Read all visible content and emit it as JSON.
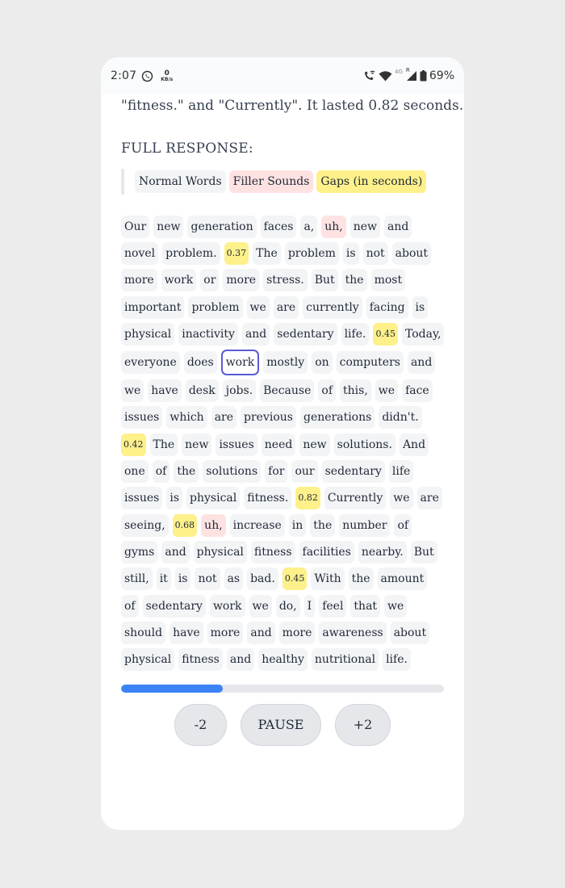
{
  "status": {
    "time": "2:07",
    "net_speed": "0",
    "net_unit": "KB/s",
    "network": "4G",
    "signal_sup": "R",
    "battery": "69%"
  },
  "summary_line": "\"fitness.\" and \"Currently\". It lasted 0.82 seconds.",
  "section_title": "FULL RESPONSE:",
  "legend": {
    "normal": "Normal Words",
    "filler": "Filler Sounds",
    "gap": "Gaps (in seconds)"
  },
  "transcript_rows": [
    [
      {
        "t": "Our",
        "k": "normal"
      },
      {
        "t": "new",
        "k": "normal"
      },
      {
        "t": "generation",
        "k": "normal"
      },
      {
        "t": "faces",
        "k": "normal"
      },
      {
        "t": "a,",
        "k": "normal"
      },
      {
        "t": "uh,",
        "k": "filler"
      },
      {
        "t": "new",
        "k": "normal"
      },
      {
        "t": "and",
        "k": "normal"
      }
    ],
    [
      {
        "t": "novel",
        "k": "normal"
      },
      {
        "t": "problem.",
        "k": "normal"
      },
      {
        "t": "0.37",
        "k": "gap"
      },
      {
        "t": "The",
        "k": "normal"
      },
      {
        "t": "problem",
        "k": "normal"
      },
      {
        "t": "is",
        "k": "normal"
      },
      {
        "t": "not",
        "k": "normal"
      },
      {
        "t": "about",
        "k": "normal"
      }
    ],
    [
      {
        "t": "more",
        "k": "normal"
      },
      {
        "t": "work",
        "k": "normal"
      },
      {
        "t": "or",
        "k": "normal"
      },
      {
        "t": "more",
        "k": "normal"
      },
      {
        "t": "stress.",
        "k": "normal"
      },
      {
        "t": "But",
        "k": "normal"
      },
      {
        "t": "the",
        "k": "normal"
      },
      {
        "t": "most",
        "k": "normal"
      }
    ],
    [
      {
        "t": "important",
        "k": "normal"
      },
      {
        "t": "problem",
        "k": "normal"
      },
      {
        "t": "we",
        "k": "normal"
      },
      {
        "t": "are",
        "k": "normal"
      },
      {
        "t": "currently",
        "k": "normal"
      },
      {
        "t": "facing",
        "k": "normal"
      },
      {
        "t": "is",
        "k": "normal"
      }
    ],
    [
      {
        "t": "physical",
        "k": "normal"
      },
      {
        "t": "inactivity",
        "k": "normal"
      },
      {
        "t": "and",
        "k": "normal"
      },
      {
        "t": "sedentary",
        "k": "normal"
      },
      {
        "t": "life.",
        "k": "normal"
      },
      {
        "t": "0.45",
        "k": "gap"
      },
      {
        "t": "Today,",
        "k": "normal"
      }
    ],
    [
      {
        "t": "everyone",
        "k": "normal"
      },
      {
        "t": "does",
        "k": "normal"
      },
      {
        "t": "work",
        "k": "active"
      },
      {
        "t": "mostly",
        "k": "normal"
      },
      {
        "t": "on",
        "k": "normal"
      },
      {
        "t": "computers",
        "k": "normal"
      },
      {
        "t": "and",
        "k": "normal"
      }
    ],
    [
      {
        "t": "we",
        "k": "normal"
      },
      {
        "t": "have",
        "k": "normal"
      },
      {
        "t": "desk",
        "k": "normal"
      },
      {
        "t": "jobs.",
        "k": "normal"
      },
      {
        "t": "Because",
        "k": "normal"
      },
      {
        "t": "of",
        "k": "normal"
      },
      {
        "t": "this,",
        "k": "normal"
      },
      {
        "t": "we",
        "k": "normal"
      },
      {
        "t": "face",
        "k": "normal"
      }
    ],
    [
      {
        "t": "issues",
        "k": "normal"
      },
      {
        "t": "which",
        "k": "normal"
      },
      {
        "t": "are",
        "k": "normal"
      },
      {
        "t": "previous",
        "k": "normal"
      },
      {
        "t": "generations",
        "k": "normal"
      },
      {
        "t": "didn't.",
        "k": "normal"
      }
    ],
    [
      {
        "t": "0.42",
        "k": "gap"
      },
      {
        "t": "The",
        "k": "normal"
      },
      {
        "t": "new",
        "k": "normal"
      },
      {
        "t": "issues",
        "k": "normal"
      },
      {
        "t": "need",
        "k": "normal"
      },
      {
        "t": "new",
        "k": "normal"
      },
      {
        "t": "solutions.",
        "k": "normal"
      },
      {
        "t": "And",
        "k": "normal"
      }
    ],
    [
      {
        "t": "one",
        "k": "normal"
      },
      {
        "t": "of",
        "k": "normal"
      },
      {
        "t": "the",
        "k": "normal"
      },
      {
        "t": "solutions",
        "k": "normal"
      },
      {
        "t": "for",
        "k": "normal"
      },
      {
        "t": "our",
        "k": "normal"
      },
      {
        "t": "sedentary",
        "k": "normal"
      },
      {
        "t": "life",
        "k": "normal"
      }
    ],
    [
      {
        "t": "issues",
        "k": "normal"
      },
      {
        "t": "is",
        "k": "normal"
      },
      {
        "t": "physical",
        "k": "normal"
      },
      {
        "t": "fitness.",
        "k": "normal"
      },
      {
        "t": "0.82",
        "k": "gap"
      },
      {
        "t": "Currently",
        "k": "normal"
      },
      {
        "t": "we",
        "k": "normal"
      },
      {
        "t": "are",
        "k": "normal"
      }
    ],
    [
      {
        "t": "seeing,",
        "k": "normal"
      },
      {
        "t": "0.68",
        "k": "gap"
      },
      {
        "t": "uh,",
        "k": "filler"
      },
      {
        "t": "increase",
        "k": "normal"
      },
      {
        "t": "in",
        "k": "normal"
      },
      {
        "t": "the",
        "k": "normal"
      },
      {
        "t": "number",
        "k": "normal"
      },
      {
        "t": "of",
        "k": "normal"
      }
    ],
    [
      {
        "t": "gyms",
        "k": "normal"
      },
      {
        "t": "and",
        "k": "normal"
      },
      {
        "t": "physical",
        "k": "normal"
      },
      {
        "t": "fitness",
        "k": "normal"
      },
      {
        "t": "facilities",
        "k": "normal"
      },
      {
        "t": "nearby.",
        "k": "normal"
      },
      {
        "t": "But",
        "k": "normal"
      }
    ],
    [
      {
        "t": "still,",
        "k": "normal"
      },
      {
        "t": "it",
        "k": "normal"
      },
      {
        "t": "is",
        "k": "normal"
      },
      {
        "t": "not",
        "k": "normal"
      },
      {
        "t": "as",
        "k": "normal"
      },
      {
        "t": "bad.",
        "k": "normal"
      },
      {
        "t": "0.45",
        "k": "gap"
      },
      {
        "t": "With",
        "k": "normal"
      },
      {
        "t": "the",
        "k": "normal"
      },
      {
        "t": "amount",
        "k": "normal"
      }
    ],
    [
      {
        "t": "of",
        "k": "normal"
      },
      {
        "t": "sedentary",
        "k": "normal"
      },
      {
        "t": "work",
        "k": "normal"
      },
      {
        "t": "we",
        "k": "normal"
      },
      {
        "t": "do,",
        "k": "normal"
      },
      {
        "t": "I",
        "k": "normal"
      },
      {
        "t": "feel",
        "k": "normal"
      },
      {
        "t": "that",
        "k": "normal"
      },
      {
        "t": "we",
        "k": "normal"
      }
    ],
    [
      {
        "t": "should",
        "k": "normal"
      },
      {
        "t": "have",
        "k": "normal"
      },
      {
        "t": "more",
        "k": "normal"
      },
      {
        "t": "and",
        "k": "normal"
      },
      {
        "t": "more",
        "k": "normal"
      },
      {
        "t": "awareness",
        "k": "normal"
      },
      {
        "t": "about",
        "k": "normal"
      }
    ],
    [
      {
        "t": "physical",
        "k": "normal"
      },
      {
        "t": "fitness",
        "k": "normal"
      },
      {
        "t": "and",
        "k": "normal"
      },
      {
        "t": "healthy",
        "k": "normal"
      },
      {
        "t": "nutritional",
        "k": "normal"
      },
      {
        "t": "life.",
        "k": "normal"
      }
    ]
  ],
  "progress": 0.315,
  "controls": {
    "back_label": "-2",
    "pause_label": "PAUSE",
    "forward_label": "+2"
  }
}
